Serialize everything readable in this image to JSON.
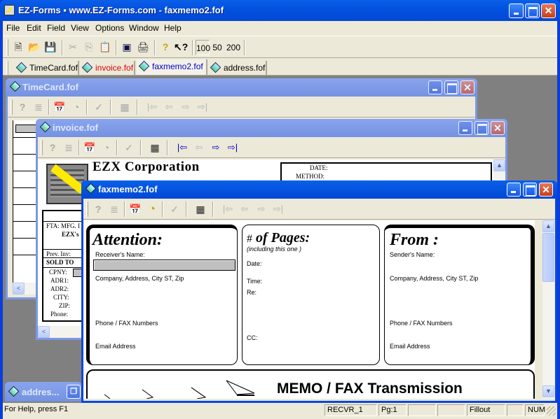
{
  "app": {
    "title": "EZ-Forms  ▪  www.EZ-Forms.com - faxmemo2.fof",
    "window_buttons": {
      "minimize": "_",
      "maximize": "□",
      "close": "✕"
    }
  },
  "menu": [
    {
      "label": "File",
      "key": "F"
    },
    {
      "label": "Edit",
      "key": "E"
    },
    {
      "label": "Field",
      "key": "i"
    },
    {
      "label": "View",
      "key": "V"
    },
    {
      "label": "Options",
      "key": "O"
    },
    {
      "label": "Window",
      "key": "W"
    },
    {
      "label": "Help",
      "key": "H"
    }
  ],
  "toolbar": {
    "new": "🗎",
    "open": "📂",
    "save": "💾",
    "cut": "✂",
    "copy": "⎘",
    "paste": "📋",
    "form": "▣",
    "print": "🖨",
    "help": "?",
    "context_help": "↖?",
    "zoom_100": "100",
    "zoom_50": "50",
    "zoom_200": "200"
  },
  "doc_tabs": [
    {
      "label": "TimeCard.fof",
      "color": "#000000"
    },
    {
      "label": "invoice.fof",
      "color": "#e00000"
    },
    {
      "label": "faxmemo2.fof",
      "color": "#0000c8",
      "active": true
    },
    {
      "label": "address.fof",
      "color": "#000000"
    }
  ],
  "child_toolbar": {
    "help": "?",
    "list": "≣",
    "calendar": "📅",
    "clock": "◔",
    "check": "✓",
    "calculator": "▦",
    "first": "|⇦",
    "prev": "⇦",
    "next": "⇨",
    "last": "⇨|"
  },
  "windows": {
    "timecard": {
      "title": "TimeCard.fof"
    },
    "invoice": {
      "title": "invoice.fof",
      "company": "EZX Corporation",
      "date_label": "DATE:",
      "method_label": "METHOD:",
      "fta_label": "FTA: MFG. I",
      "ezx_label": "EZX's",
      "prev_inv": "Prev. Inv:",
      "sold_to": "SOLD TO",
      "fields": [
        "CPNY:",
        "ADR1:",
        "ADR2:",
        "CITY:",
        "ZIP:",
        "Phone:"
      ]
    },
    "faxmemo": {
      "title": "faxmemo2.fof",
      "attention": {
        "heading": "Attention:",
        "receiver_label": "Receiver's Name:",
        "receiver_value": "",
        "company_label": "Company, Address, City ST, Zip",
        "phone_label": "Phone / FAX Numbers",
        "email_label": "Email Address"
      },
      "pages": {
        "hash": "#",
        "heading": "of Pages:",
        "sub": "(including this one )",
        "date_label": "Date:",
        "time_label": "Time:",
        "re_label": "Re:",
        "cc_label": "CC:"
      },
      "from": {
        "heading": "From :",
        "sender_label": "Sender's Name:",
        "company_label": "Company, Address, City ST, Zip",
        "phone_label": "Phone / FAX Numbers",
        "email_label": "Email Address"
      },
      "banner": "MEMO / FAX Transmission"
    },
    "address_minimized": {
      "title": "addres..."
    }
  },
  "statusbar": {
    "help": "For Help, press F1",
    "field": "RECVR_1",
    "page": "Pg:1",
    "blank1": "",
    "blank2": "",
    "mode": "Fillout",
    "blank3": "",
    "num": "NUM"
  }
}
